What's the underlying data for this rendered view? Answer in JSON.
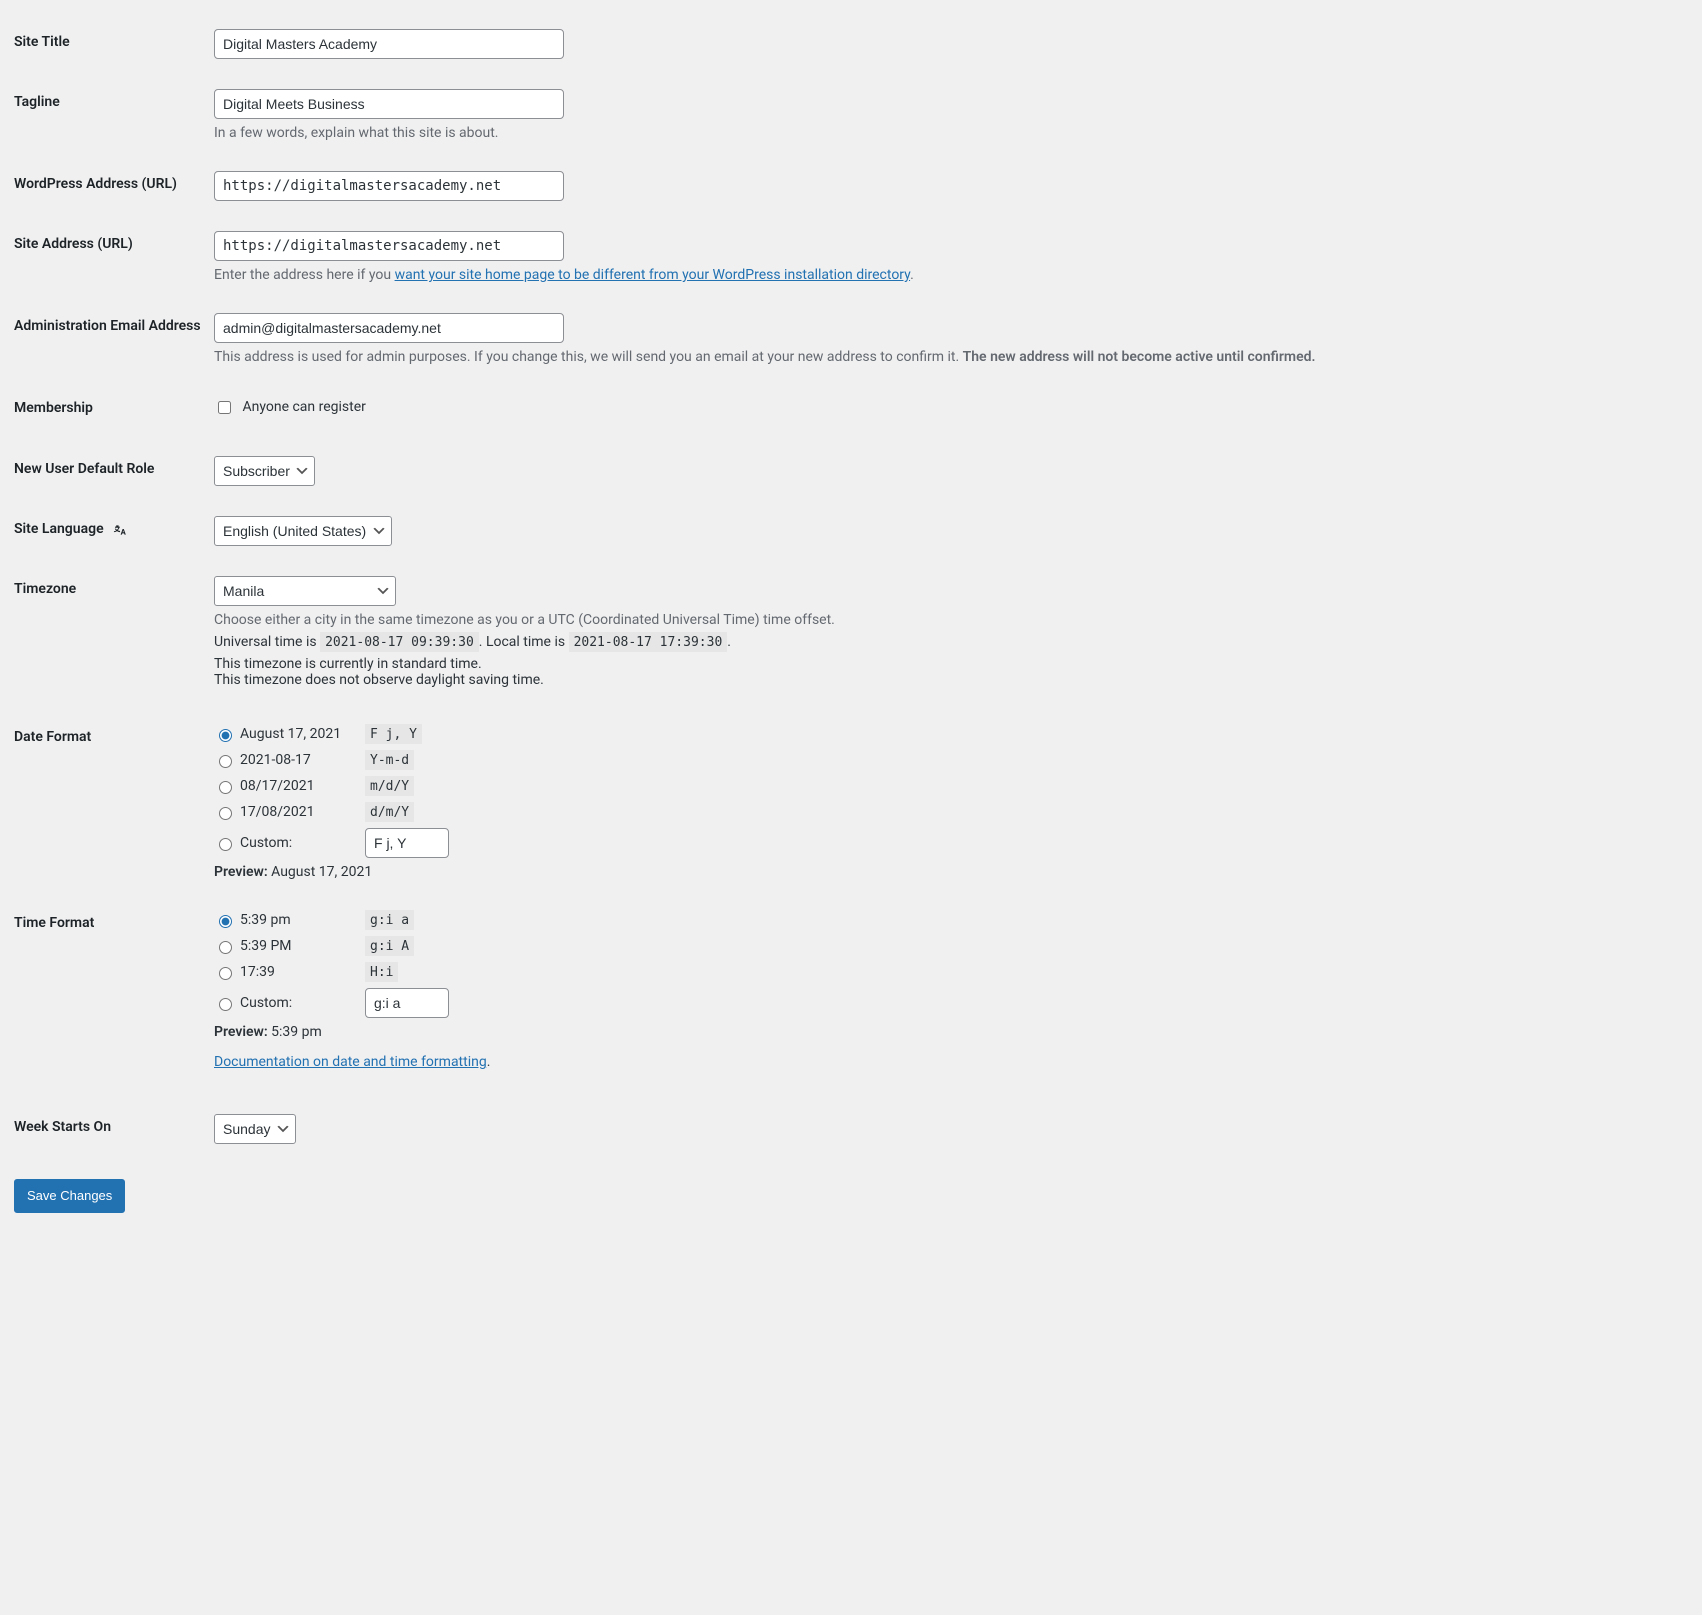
{
  "fields": {
    "site_title": {
      "label": "Site Title",
      "value": "Digital Masters Academy"
    },
    "tagline": {
      "label": "Tagline",
      "value": "Digital Meets Business",
      "help": "In a few words, explain what this site is about."
    },
    "wp_address": {
      "label": "WordPress Address (URL)",
      "value": "https://digitalmastersacademy.net"
    },
    "site_address": {
      "label": "Site Address (URL)",
      "value": "https://digitalmastersacademy.net",
      "help_pre": "Enter the address here if you ",
      "help_link": "want your site home page to be different from your WordPress installation directory",
      "help_post": "."
    },
    "admin_email": {
      "label": "Administration Email Address",
      "value": "admin@digitalmastersacademy.net",
      "help_a": "This address is used for admin purposes. If you change this, we will send you an email at your new address to confirm it. ",
      "help_b": "The new address will not become active until confirmed.",
      "help_c": ""
    },
    "membership": {
      "label": "Membership",
      "checkbox_label": "Anyone can register"
    },
    "default_role": {
      "label": "New User Default Role",
      "value": "Subscriber"
    },
    "site_language": {
      "label": "Site Language",
      "value": "English (United States)"
    },
    "timezone": {
      "label": "Timezone",
      "value": "Manila",
      "help": "Choose either a city in the same timezone as you or a UTC (Coordinated Universal Time) time offset.",
      "utc_pre": "Universal time is ",
      "utc_code": "2021-08-17 09:39:30",
      "utc_mid": ". Local time is ",
      "local_code": "2021-08-17 17:39:30",
      "utc_post": ".",
      "std_a": "This timezone is currently in standard time.",
      "std_b": "This timezone does not observe daylight saving time."
    },
    "date_format": {
      "label": "Date Format",
      "options": [
        {
          "label": "August 17, 2021",
          "code": "F j, Y",
          "checked": true
        },
        {
          "label": "2021-08-17",
          "code": "Y-m-d"
        },
        {
          "label": "08/17/2021",
          "code": "m/d/Y"
        },
        {
          "label": "17/08/2021",
          "code": "d/m/Y"
        }
      ],
      "custom_label": "Custom:",
      "custom_value": "F j, Y",
      "preview_label": "Preview:",
      "preview_value": "August 17, 2021"
    },
    "time_format": {
      "label": "Time Format",
      "options": [
        {
          "label": "5:39 pm",
          "code": "g:i a",
          "checked": true
        },
        {
          "label": "5:39 PM",
          "code": "g:i A"
        },
        {
          "label": "17:39",
          "code": "H:i"
        }
      ],
      "custom_label": "Custom:",
      "custom_value": "g:i a",
      "preview_label": "Preview:",
      "preview_value": "5:39 pm",
      "doc_link": "Documentation on date and time formatting",
      "doc_post": "."
    },
    "week_starts": {
      "label": "Week Starts On",
      "value": "Sunday"
    }
  },
  "save_button": "Save Changes"
}
